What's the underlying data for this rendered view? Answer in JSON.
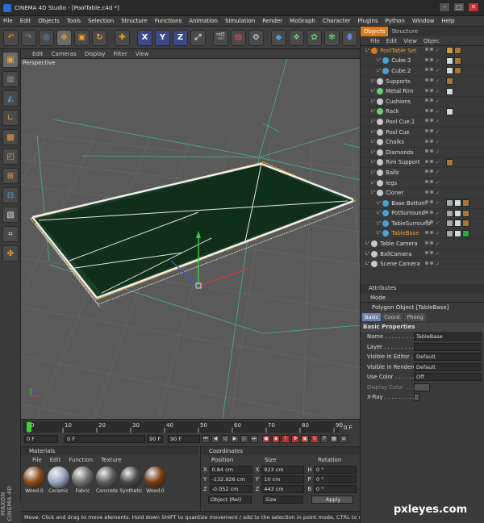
{
  "app": {
    "title": "CINEMA 4D Studio - [PoolTable.c4d *]"
  },
  "menu": [
    "File",
    "Edit",
    "Objects",
    "Tools",
    "Selection",
    "Structure",
    "Functions",
    "Animation",
    "Simulation",
    "Render",
    "MoGraph",
    "Character",
    "Plugins",
    "Python",
    "Window",
    "Help"
  ],
  "toolbar": {
    "x_label": "X",
    "y_label": "Y",
    "z_label": "Z"
  },
  "viewport": {
    "menu": [
      "Edit",
      "Cameras",
      "Display",
      "Filter",
      "View"
    ],
    "label": "Perspective"
  },
  "timeline": {
    "ticks": [
      "0",
      "10",
      "20",
      "30",
      "40",
      "50",
      "60",
      "70",
      "80",
      "90"
    ],
    "end_label": "0 F"
  },
  "playbar": {
    "current": "0 F",
    "min": "0 F",
    "preview": "90 F",
    "max": "90 F"
  },
  "materials": {
    "header": "Materials",
    "menu": [
      "File",
      "Edit",
      "Function",
      "Texture"
    ],
    "items": [
      {
        "name": "Wood.0",
        "color": "#8a4a1a"
      },
      {
        "name": "Ceramic",
        "color": "#9aa7c0"
      },
      {
        "name": "Fabric",
        "color": "#6f6f6f"
      },
      {
        "name": "Concrete",
        "color": "#5d5d5d"
      },
      {
        "name": "Synthetic",
        "color": "#4a4a4a"
      },
      {
        "name": "Wood.0",
        "color": "#7a3f14"
      }
    ]
  },
  "coordinates": {
    "header": "Coordinates",
    "columns": [
      "Position",
      "Size",
      "Rotation"
    ],
    "rows": [
      {
        "axis": "X",
        "pos": "0.84 cm",
        "size_axis": "X",
        "size": "923 cm",
        "rot_axis": "H",
        "rot": "0 °"
      },
      {
        "axis": "Y",
        "pos": "-132.926 cm",
        "size_axis": "Y",
        "size": "10 cm",
        "rot_axis": "P",
        "rot": "0 °"
      },
      {
        "axis": "Z",
        "pos": "-0.052 cm",
        "size_axis": "Z",
        "size": "443 cm",
        "rot_axis": "B",
        "rot": "0 °"
      }
    ],
    "mode": "Object (Rel)",
    "size_mode": "Size",
    "apply": "Apply"
  },
  "status": "Move: Click and drag to move elements. Hold down SHIFT to quantize movement / add to the selection in point mode, CTRL to remove",
  "maxon": "MAXON CINEMA 4D",
  "objects": {
    "tabs": [
      "Objects",
      "Structure"
    ],
    "menu": [
      "File",
      "Edit",
      "View",
      "Objec"
    ],
    "items": [
      {
        "name": "PoolTable Set",
        "indent": 0,
        "color": "#e07a17",
        "label_color": "#f0a030"
      },
      {
        "name": "Cube.3",
        "indent": 2,
        "color": "#4aa0d8",
        "label_color": "#dddddd"
      },
      {
        "name": "Cube.2",
        "indent": 2,
        "color": "#4aa0d8",
        "label_color": "#dddddd"
      },
      {
        "name": "Supports",
        "indent": 1,
        "color": "#c8c8c8",
        "label_color": "#dddddd"
      },
      {
        "name": "Metal Rim",
        "indent": 1,
        "color": "#6ad06a",
        "label_color": "#dddddd"
      },
      {
        "name": "Cushions",
        "indent": 1,
        "color": "#c8c8c8",
        "label_color": "#dddddd"
      },
      {
        "name": "Rack",
        "indent": 1,
        "color": "#6ad06a",
        "label_color": "#dddddd"
      },
      {
        "name": "Pool Cue.1",
        "indent": 1,
        "color": "#c8c8c8",
        "label_color": "#dddddd"
      },
      {
        "name": "Pool Cue",
        "indent": 1,
        "color": "#c8c8c8",
        "label_color": "#dddddd"
      },
      {
        "name": "Chalks",
        "indent": 1,
        "color": "#c8c8c8",
        "label_color": "#dddddd"
      },
      {
        "name": "Diamonds",
        "indent": 1,
        "color": "#c8c8c8",
        "label_color": "#dddddd"
      },
      {
        "name": "Rim Support",
        "indent": 1,
        "color": "#c8c8c8",
        "label_color": "#dddddd"
      },
      {
        "name": "Balls",
        "indent": 1,
        "color": "#c8c8c8",
        "label_color": "#dddddd"
      },
      {
        "name": "legs",
        "indent": 1,
        "color": "#c8c8c8",
        "label_color": "#dddddd"
      },
      {
        "name": "Cloner",
        "indent": 1,
        "color": "#c8c8c8",
        "label_color": "#dddddd"
      },
      {
        "name": "Base Bottom",
        "indent": 2,
        "color": "#4aa0d8",
        "label_color": "#dddddd"
      },
      {
        "name": "PotSurround",
        "indent": 2,
        "color": "#4aa0d8",
        "label_color": "#dddddd"
      },
      {
        "name": "TableSurround",
        "indent": 2,
        "color": "#4aa0d8",
        "label_color": "#dddddd"
      },
      {
        "name": "TableBase",
        "indent": 2,
        "color": "#4aa0d8",
        "label_color": "#f0a030"
      },
      {
        "name": "Table Camera",
        "indent": 0,
        "color": "#c8c8c8",
        "label_color": "#dddddd"
      },
      {
        "name": "BallCamera",
        "indent": 0,
        "color": "#c8c8c8",
        "label_color": "#dddddd"
      },
      {
        "name": "Scene Camera",
        "indent": 0,
        "color": "#c8c8c8",
        "label_color": "#dddddd"
      }
    ]
  },
  "attributes": {
    "header": "Attributes",
    "mode": "Mode",
    "object": "Polygon Object [TableBase]",
    "tabs": [
      "Basic",
      "Coord.",
      "Phong"
    ],
    "section": "Basic Properties",
    "rows": [
      {
        "label": "Name . . . . . . . . . .",
        "value": "TableBase",
        "dim": false
      },
      {
        "label": "Layer . . . . . . . . . .",
        "value": "",
        "dim": false
      },
      {
        "label": "Visible in Editor . . .",
        "value": "Default",
        "dim": false
      },
      {
        "label": "Visible in Renderer .",
        "value": "Default",
        "dim": false
      },
      {
        "label": "Use Color . . . . . . .",
        "value": "Off",
        "dim": false
      },
      {
        "label": "Display Color . . . .",
        "value": "",
        "dim": true
      },
      {
        "label": "X-Ray . . . . . . . . .",
        "value": "",
        "dim": false
      }
    ]
  },
  "watermark": "pxleyes.com"
}
